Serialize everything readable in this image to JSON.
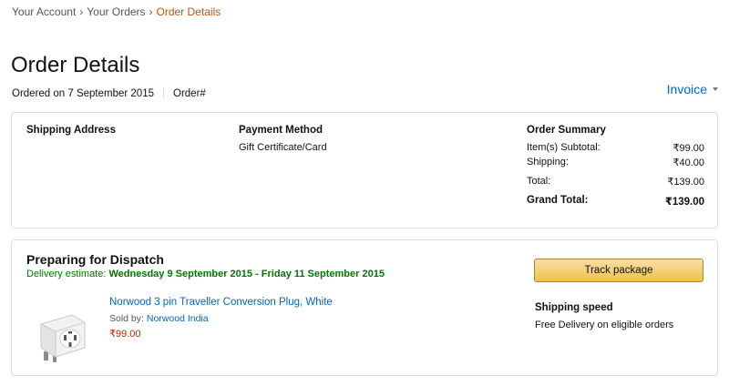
{
  "breadcrumb": {
    "items": [
      "Your Account",
      "Your Orders"
    ],
    "separator": "›",
    "current": "Order Details"
  },
  "page": {
    "title": "Order Details",
    "ordered_on": "Ordered on 7 September 2015",
    "order_number_label": "Order#",
    "invoice_label": "Invoice"
  },
  "summary": {
    "shipping_address_title": "Shipping Address",
    "payment_method_title": "Payment Method",
    "payment_method_value": "Gift Certificate/Card",
    "order_summary_title": "Order Summary",
    "rows": [
      {
        "label": "Item(s) Subtotal:",
        "value": "₹99.00"
      },
      {
        "label": "Shipping:",
        "value": "₹40.00"
      },
      {
        "label": "Total:",
        "value": "₹139.00"
      },
      {
        "label": "Grand Total:",
        "value": "₹139.00"
      }
    ]
  },
  "shipment": {
    "status": "Preparing for Dispatch",
    "delivery_prefix": "Delivery estimate:",
    "delivery_dates": "Wednesday 9 September 2015 - Friday 11 September 2015",
    "product_name": "Norwood 3 pin Traveller Conversion Plug, White",
    "sold_by_label": "Sold by:",
    "seller": "Norwood India",
    "price": "₹99.00",
    "track_button": "Track package",
    "shipping_speed_title": "Shipping speed",
    "shipping_speed_text": "Free Delivery on eligible orders"
  },
  "colors": {
    "link": "#0066c0",
    "breadcrumb_current": "#c45500",
    "delivery_green": "#007600",
    "price_red": "#b12704",
    "button_yellow": "#f0c14b"
  },
  "icons": {
    "invoice_caret": "chevron-down-icon",
    "product": "plug-adapter-image"
  }
}
